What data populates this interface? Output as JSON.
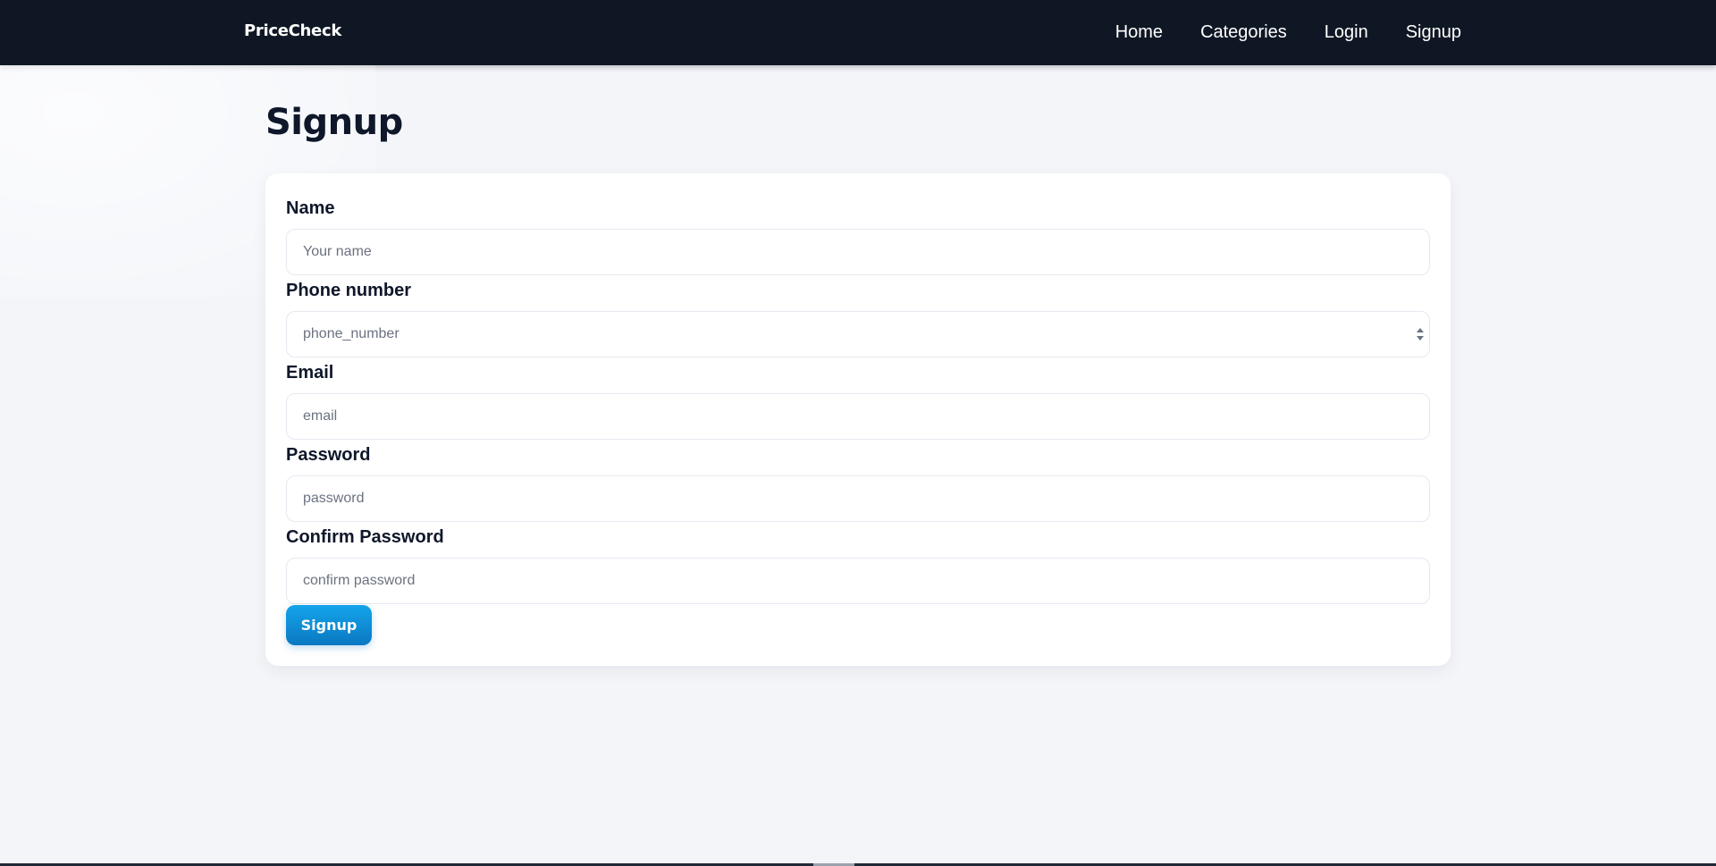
{
  "brand": "PriceCheck",
  "nav": {
    "items": [
      {
        "label": "Home"
      },
      {
        "label": "Categories"
      },
      {
        "label": "Login"
      },
      {
        "label": "Signup"
      }
    ]
  },
  "page": {
    "title": "Signup"
  },
  "form": {
    "fields": [
      {
        "label": "Name",
        "placeholder": "Your name",
        "value": ""
      },
      {
        "label": "Phone number",
        "placeholder": "phone_number",
        "value": ""
      },
      {
        "label": "Email",
        "placeholder": "email",
        "value": ""
      },
      {
        "label": "Password",
        "placeholder": "password",
        "value": ""
      },
      {
        "label": "Confirm Password",
        "placeholder": "confirm password",
        "value": ""
      }
    ],
    "submit_label": "Signup"
  },
  "colors": {
    "navbar_bg": "#0f1724",
    "page_bg": "#f3f5f9",
    "button_accent": "#0ea5e9"
  },
  "icons": {
    "phone_spinner": "spinner-arrows-icon"
  }
}
